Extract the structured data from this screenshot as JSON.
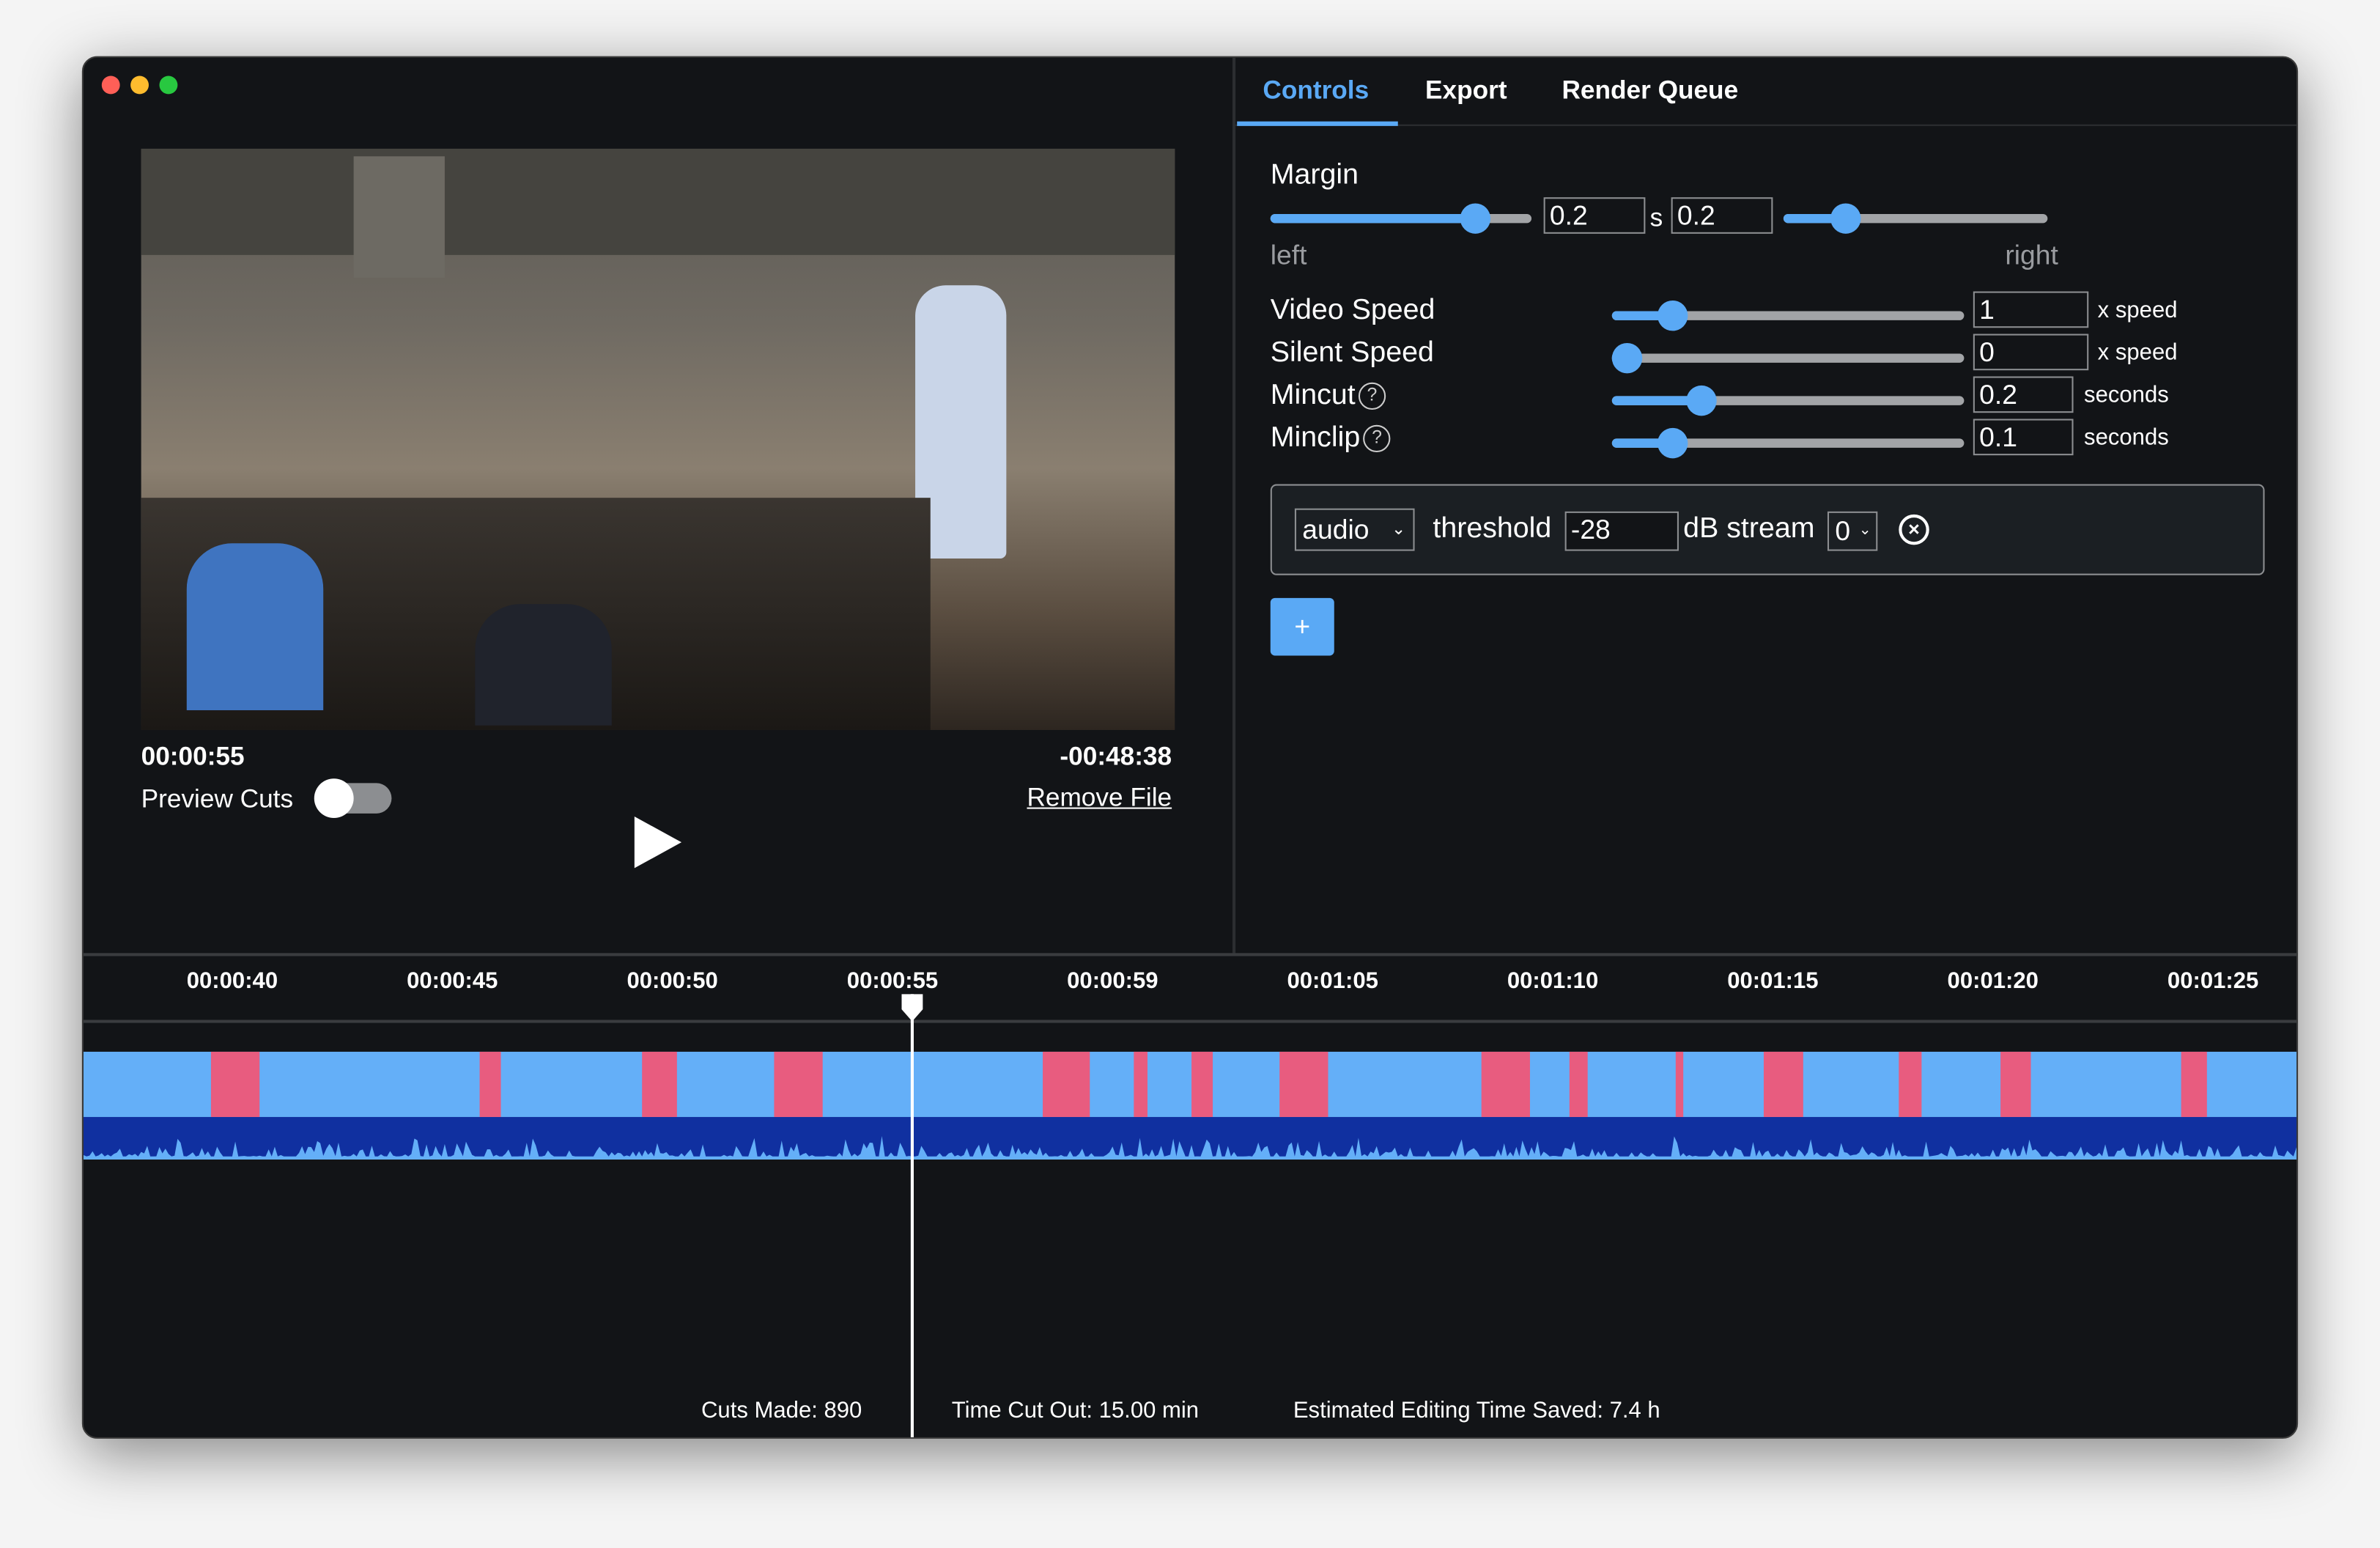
{
  "window": {
    "controls": [
      {
        "name": "close",
        "color": "#ff5f57"
      },
      {
        "name": "minimize",
        "color": "#febc2e"
      },
      {
        "name": "zoom",
        "color": "#28c840"
      }
    ]
  },
  "player": {
    "current_time": "00:00:55",
    "remaining_time": "-00:48:38",
    "preview_cuts_label": "Preview Cuts",
    "preview_cuts_on": false,
    "remove_file_label": "Remove File",
    "play_icon": "play-icon"
  },
  "tabs": [
    {
      "label": "Controls",
      "active": true
    },
    {
      "label": "Export",
      "active": false
    },
    {
      "label": "Render Queue",
      "active": false
    }
  ],
  "controls": {
    "margin": {
      "label": "Margin",
      "left_value": "0.2",
      "unit": "s",
      "right_value": "0.2",
      "left_label": "left",
      "right_label": "right",
      "left_slider_fraction": 0.82,
      "right_slider_fraction": 0.2
    },
    "rows": [
      {
        "label": "Video Speed",
        "value": "1",
        "unit": "x speed",
        "slider_fraction": 0.14,
        "help": false
      },
      {
        "label": "Silent Speed",
        "value": "0",
        "unit": "x speed",
        "slider_fraction": 0.0,
        "help": false
      },
      {
        "label": "Mincut",
        "value": "0.2",
        "unit": "seconds",
        "slider_fraction": 0.23,
        "help": true
      },
      {
        "label": "Minclip",
        "value": "0.1",
        "unit": "seconds",
        "slider_fraction": 0.14,
        "help": true
      }
    ],
    "method": {
      "type": "audio",
      "threshold_label": "threshold",
      "threshold": "-28",
      "db_stream_label": "dB stream",
      "stream": "0"
    },
    "add_label": "+"
  },
  "timeline": {
    "ticks": [
      "00:00:40",
      "00:00:45",
      "00:00:50",
      "00:00:55",
      "00:00:59",
      "00:01:05",
      "00:01:10",
      "00:01:15",
      "00:01:20",
      "00:01:25"
    ],
    "view_seconds": [
      36.6,
      87.0
    ],
    "playhead_seconds": 55.4,
    "cuts_seconds": [
      [
        39.5,
        40.6
      ],
      [
        45.6,
        46.1
      ],
      [
        49.3,
        50.1
      ],
      [
        52.3,
        53.4
      ],
      [
        58.4,
        59.5
      ],
      [
        60.5,
        60.8
      ],
      [
        61.8,
        62.3
      ],
      [
        63.8,
        64.9
      ],
      [
        68.4,
        69.5
      ],
      [
        70.4,
        70.8
      ],
      [
        72.8,
        73.0
      ],
      [
        74.8,
        75.7
      ],
      [
        77.9,
        78.4
      ],
      [
        80.2,
        80.9
      ],
      [
        84.3,
        84.9
      ]
    ],
    "colors": {
      "keep": "#64aff8",
      "cut": "#e85c7f",
      "wave_bg": "#1030a0",
      "wave": "#64aff8"
    }
  },
  "stats": {
    "cuts_made": "Cuts Made: 890",
    "time_cut_out": "Time Cut Out: 15.00 min",
    "editing_saved": "Estimated Editing Time Saved: 7.4 h"
  }
}
